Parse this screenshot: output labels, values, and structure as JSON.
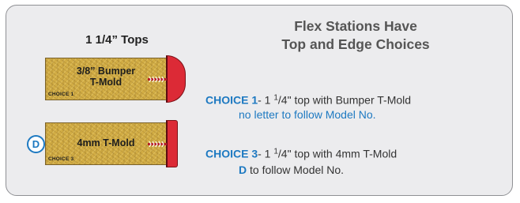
{
  "left_heading": "1 1/4” Tops",
  "right_heading": {
    "line1": "Flex Stations Have",
    "line2": "Top and Edge Choices"
  },
  "boards": [
    {
      "label_line1": "3/8” Bumper",
      "label_line2": "T-Mold",
      "tag": "CHOICE 1"
    },
    {
      "label_line1": "4mm T-Mold",
      "tag": "CHOICE 3",
      "badge": "D"
    }
  ],
  "choices": [
    {
      "label": "CHOICE 1",
      "text_pre": "- 1 ",
      "sup": "1",
      "text_post": "/4\" top with Bumper T-Mold",
      "note": "no letter to follow Model No."
    },
    {
      "label": "CHOICE 3",
      "text_pre": "- 1 ",
      "sup": "1",
      "text_post": "/4\" top with 4mm T-Mold",
      "note_letter": "D",
      "note": " to follow Model No."
    }
  ],
  "colors": {
    "accent_blue": "#1d79c1",
    "bumper_red": "#dc2a36",
    "wood": "#d2ad45"
  }
}
